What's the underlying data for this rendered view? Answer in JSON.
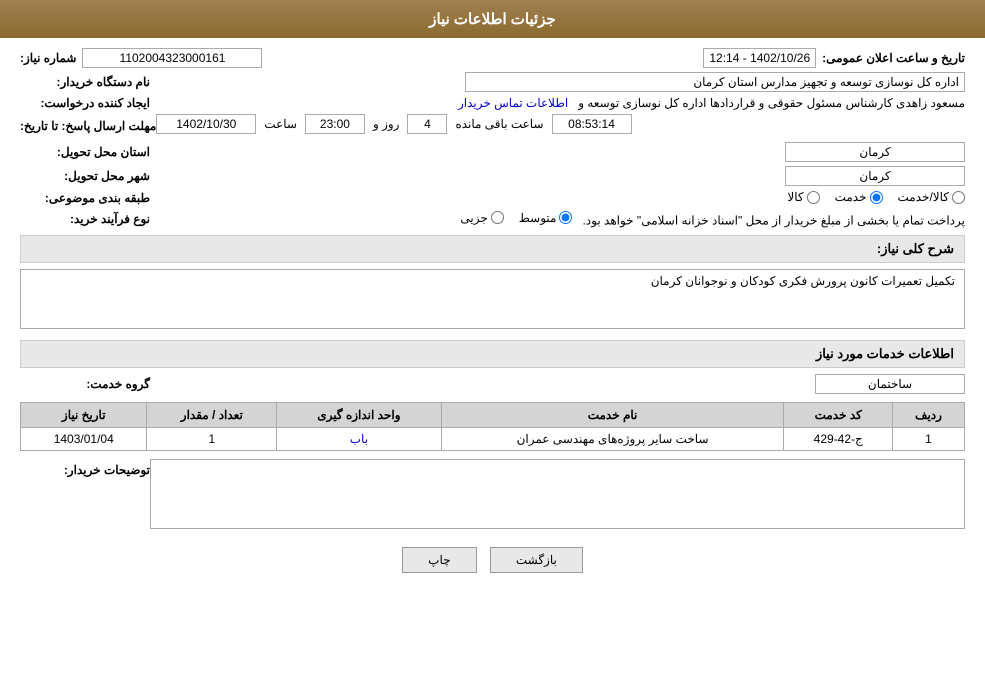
{
  "header": {
    "title": "جزئیات اطلاعات نیاز"
  },
  "topRow": {
    "shomareNiazLabel": "شماره نیاز:",
    "shomareNiazValue": "1102004323000161",
    "tarikh_label": "تاریخ و ساعت اعلان عمومی:",
    "tarikh_value": "1402/10/26 - 12:14"
  },
  "namDastgah": {
    "label": "نام دستگاه خریدار:",
    "value": "اداره کل نوسازی  توسعه و تجهیز مدارس استان کرمان"
  },
  "ijadKonande": {
    "label": "ایجاد کننده درخواست:",
    "value": "مسعود زاهدی کارشناس مسئول حقوقی و قراردادها اداره کل نوسازی  توسعه و",
    "link": "اطلاعات تماس خریدار"
  },
  "mohlat": {
    "label": "مهلت ارسال پاسخ: تا تاریخ:",
    "date": "1402/10/30",
    "saat_label": "ساعت",
    "saat_value": "23:00",
    "rooz_label": "روز و",
    "rooz_value": "4",
    "mande_label": "ساعت باقی مانده",
    "mande_value": "08:53:14"
  },
  "ostan": {
    "label": "استان محل تحویل:",
    "value": "کرمان"
  },
  "shahr": {
    "label": "شهر محل تحویل:",
    "value": "کرمان"
  },
  "tabaqe": {
    "label": "طبقه بندی موضوعی:",
    "options": [
      "کالا",
      "خدمت",
      "کالا/خدمت"
    ],
    "selected": "خدمت"
  },
  "noeFarayand": {
    "label": "نوع فرآیند خرید:",
    "options": [
      "جزیی",
      "متوسط"
    ],
    "selected": "متوسط",
    "note": "پرداخت تمام یا بخشی از مبلغ خریدار از محل \"اسناد خزانه اسلامی\" خواهد بود."
  },
  "sharhKoli": {
    "label": "شرح کلی نیاز:",
    "value": "تکمیل تعمیرات کانون پرورش فکری کودکان و نوجوانان کرمان"
  },
  "khadamatSection": {
    "title": "اطلاعات خدمات مورد نیاز"
  },
  "goroheKhadamat": {
    "label": "گروه خدمت:",
    "value": "ساختمان"
  },
  "tableHeaders": [
    "ردیف",
    "کد خدمت",
    "نام خدمت",
    "واحد اندازه گیری",
    "تعداد / مقدار",
    "تاریخ نیاز"
  ],
  "tableRows": [
    {
      "radif": "1",
      "kodKhadamat": "ج-42-429",
      "namKhadamat": "ساخت سایر پروژه‌های مهندسی عمران",
      "vahedAndaze": "باب",
      "tedad": "1",
      "tarikh": "1403/01/04"
    }
  ],
  "tosifat": {
    "label": "توضیحات خریدار:",
    "value": ""
  },
  "buttons": {
    "print": "چاپ",
    "back": "بازگشت"
  }
}
